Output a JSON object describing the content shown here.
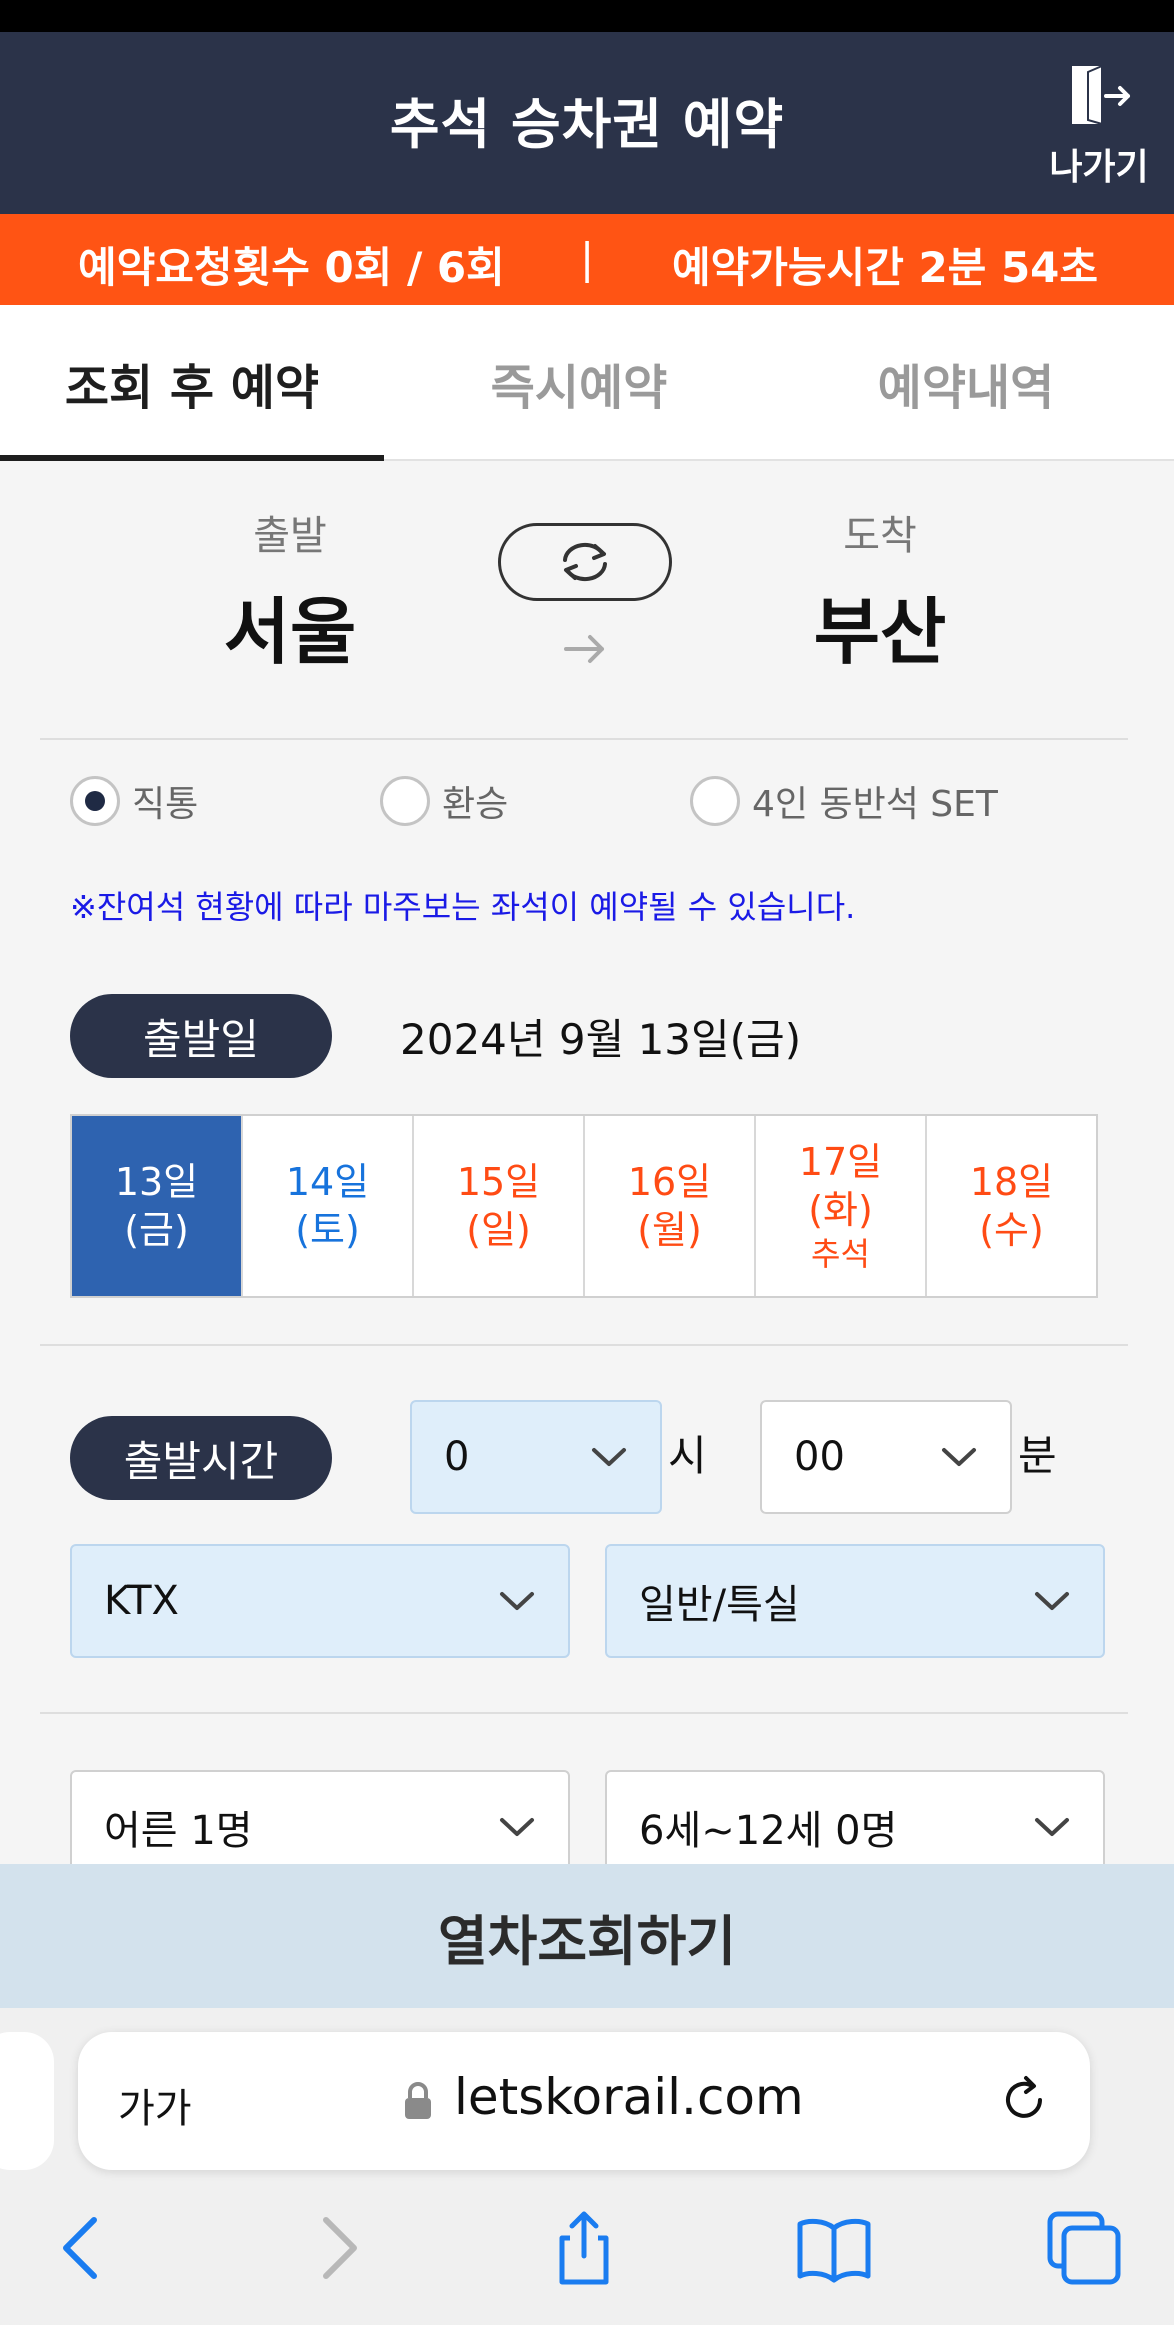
{
  "header": {
    "title": "추석 승차권 예약",
    "exit_label": "나가기"
  },
  "status": {
    "request_count": "예약요청횟수 0회 / 6회",
    "separator": "|",
    "time_left": "예약가능시간 2분 54초"
  },
  "tabs": [
    {
      "label": "조회 후 예약",
      "active": true
    },
    {
      "label": "즉시예약",
      "active": false
    },
    {
      "label": "예약내역",
      "active": false
    }
  ],
  "route": {
    "departure_label": "출발",
    "departure_station": "서울",
    "arrival_label": "도착",
    "arrival_station": "부산"
  },
  "trip_type": [
    {
      "label": "직통",
      "selected": true
    },
    {
      "label": "환승",
      "selected": false
    },
    {
      "label": "4인 동반석 SET",
      "selected": false
    }
  ],
  "notice": "※잔여석 현황에 따라 마주보는 좌석이 예약될 수 있습니다.",
  "date": {
    "pill_label": "출발일",
    "selected_text": "2024년 9월 13일(금)",
    "days": [
      {
        "day": "13일",
        "weekday": "(금)",
        "note": "",
        "style": "selected"
      },
      {
        "day": "14일",
        "weekday": "(토)",
        "note": "",
        "style": "saturday"
      },
      {
        "day": "15일",
        "weekday": "(일)",
        "note": "",
        "style": "holiday"
      },
      {
        "day": "16일",
        "weekday": "(월)",
        "note": "",
        "style": "holiday"
      },
      {
        "day": "17일",
        "weekday": "(화)",
        "note": "추석",
        "style": "holiday"
      },
      {
        "day": "18일",
        "weekday": "(수)",
        "note": "",
        "style": "holiday"
      }
    ]
  },
  "time": {
    "pill_label": "출발시간",
    "hour": "0",
    "hour_unit": "시",
    "minute": "00",
    "minute_unit": "분"
  },
  "train": {
    "type": "KTX",
    "class": "일반/특실"
  },
  "passengers": {
    "adult": "어른 1명",
    "child": "6세~12세 0명"
  },
  "search_button": "열차조회하기",
  "browser": {
    "text_size": "가가",
    "url": "letskorail.com"
  },
  "colors": {
    "navy": "#2b3349",
    "orange": "#ff5414",
    "selected_day": "#2e63b0",
    "saturday": "#1773dc",
    "holiday": "#ff4b14",
    "notice": "#1a1ae6"
  }
}
